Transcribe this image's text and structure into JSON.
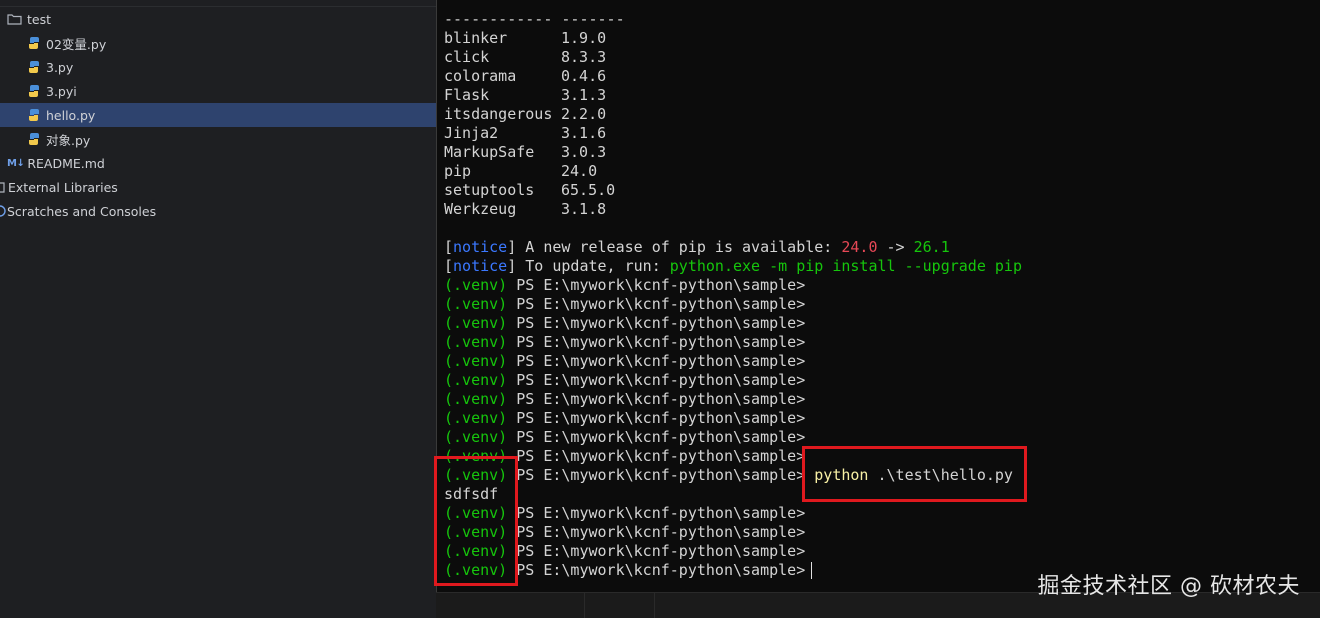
{
  "project_tree": {
    "items": [
      {
        "label": "test",
        "icon": "folder-icon"
      },
      {
        "label": "02变量.py",
        "icon": "python-file-icon"
      },
      {
        "label": "3.py",
        "icon": "python-file-icon"
      },
      {
        "label": "3.pyi",
        "icon": "python-file-icon"
      },
      {
        "label": "hello.py",
        "icon": "python-file-icon",
        "selected": true
      },
      {
        "label": "对象.py",
        "icon": "python-file-icon"
      },
      {
        "label": "README.md",
        "icon": "markdown-icon"
      },
      {
        "label": "External Libraries",
        "icon": "library-icon"
      },
      {
        "label": "Scratches and Consoles",
        "icon": "scratch-icon"
      }
    ],
    "markdown_icon_text": "M↓"
  },
  "terminal": {
    "separator_line": "------------ -------",
    "packages": [
      {
        "name": "blinker",
        "version": "1.9.0"
      },
      {
        "name": "click",
        "version": "8.3.3"
      },
      {
        "name": "colorama",
        "version": "0.4.6"
      },
      {
        "name": "Flask",
        "version": "3.1.3"
      },
      {
        "name": "itsdangerous",
        "version": "2.2.0"
      },
      {
        "name": "Jinja2",
        "version": "3.1.6"
      },
      {
        "name": "MarkupSafe",
        "version": "3.0.3"
      },
      {
        "name": "pip",
        "version": "24.0"
      },
      {
        "name": "setuptools",
        "version": "65.5.0"
      },
      {
        "name": "Werkzeug",
        "version": "3.1.8"
      }
    ],
    "notice_word": "notice",
    "notice1_text": " A new release of pip is available: ",
    "notice1_old": "24.0",
    "notice1_arrow": " -> ",
    "notice1_new": "26.1",
    "notice2_text": " To update, run: ",
    "notice2_cmd": "python.exe -m pip install --upgrade pip",
    "venv": "(.venv)",
    "prompt": " PS E:\\mywork\\kcnf-python\\sample>",
    "command_word": "python",
    "command_args": " .\\test\\hello.py",
    "output": "sdfsdf"
  },
  "watermark": "掘金技术社区 @ 砍材农夫",
  "colors": {
    "terminal_bg": "#0c0c0c",
    "sidebar_bg": "#1e1f22",
    "selection_bg": "#2e436e",
    "prompt_green": "#16c60c",
    "notice_blue": "#3b78ff",
    "version_red": "#e74856",
    "command_yellow": "#f9f1a5",
    "highlight_red": "#e0191e"
  }
}
